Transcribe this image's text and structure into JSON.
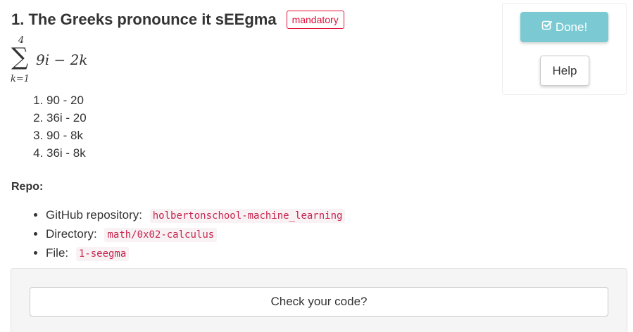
{
  "task": {
    "title": "1. The Greeks pronounce it sEEgma",
    "badge": "mandatory"
  },
  "actions": {
    "done_label": "Done!",
    "done_icon": "check-square-icon",
    "help_label": "Help"
  },
  "formula": {
    "upper_limit": "4",
    "symbol": "∑",
    "lower_limit": "k=1",
    "expression": "9i − 2k"
  },
  "choices": [
    "90 - 20",
    "36i - 20",
    "90 - 8k",
    "36i - 8k"
  ],
  "repo": {
    "label": "Repo:",
    "items": [
      {
        "label": "GitHub repository:",
        "value": "holbertonschool-machine_learning"
      },
      {
        "label": "Directory:",
        "value": "math/0x02-calculus"
      },
      {
        "label": "File:",
        "value": "1-seegma"
      }
    ]
  },
  "check": {
    "button_label": "Check your code?"
  },
  "colors": {
    "badge": "#e0113a",
    "done_button": "#7bcad3",
    "code_text": "#c7254e",
    "code_background": "#f9f2f4",
    "well_background": "#f5f5f5"
  }
}
